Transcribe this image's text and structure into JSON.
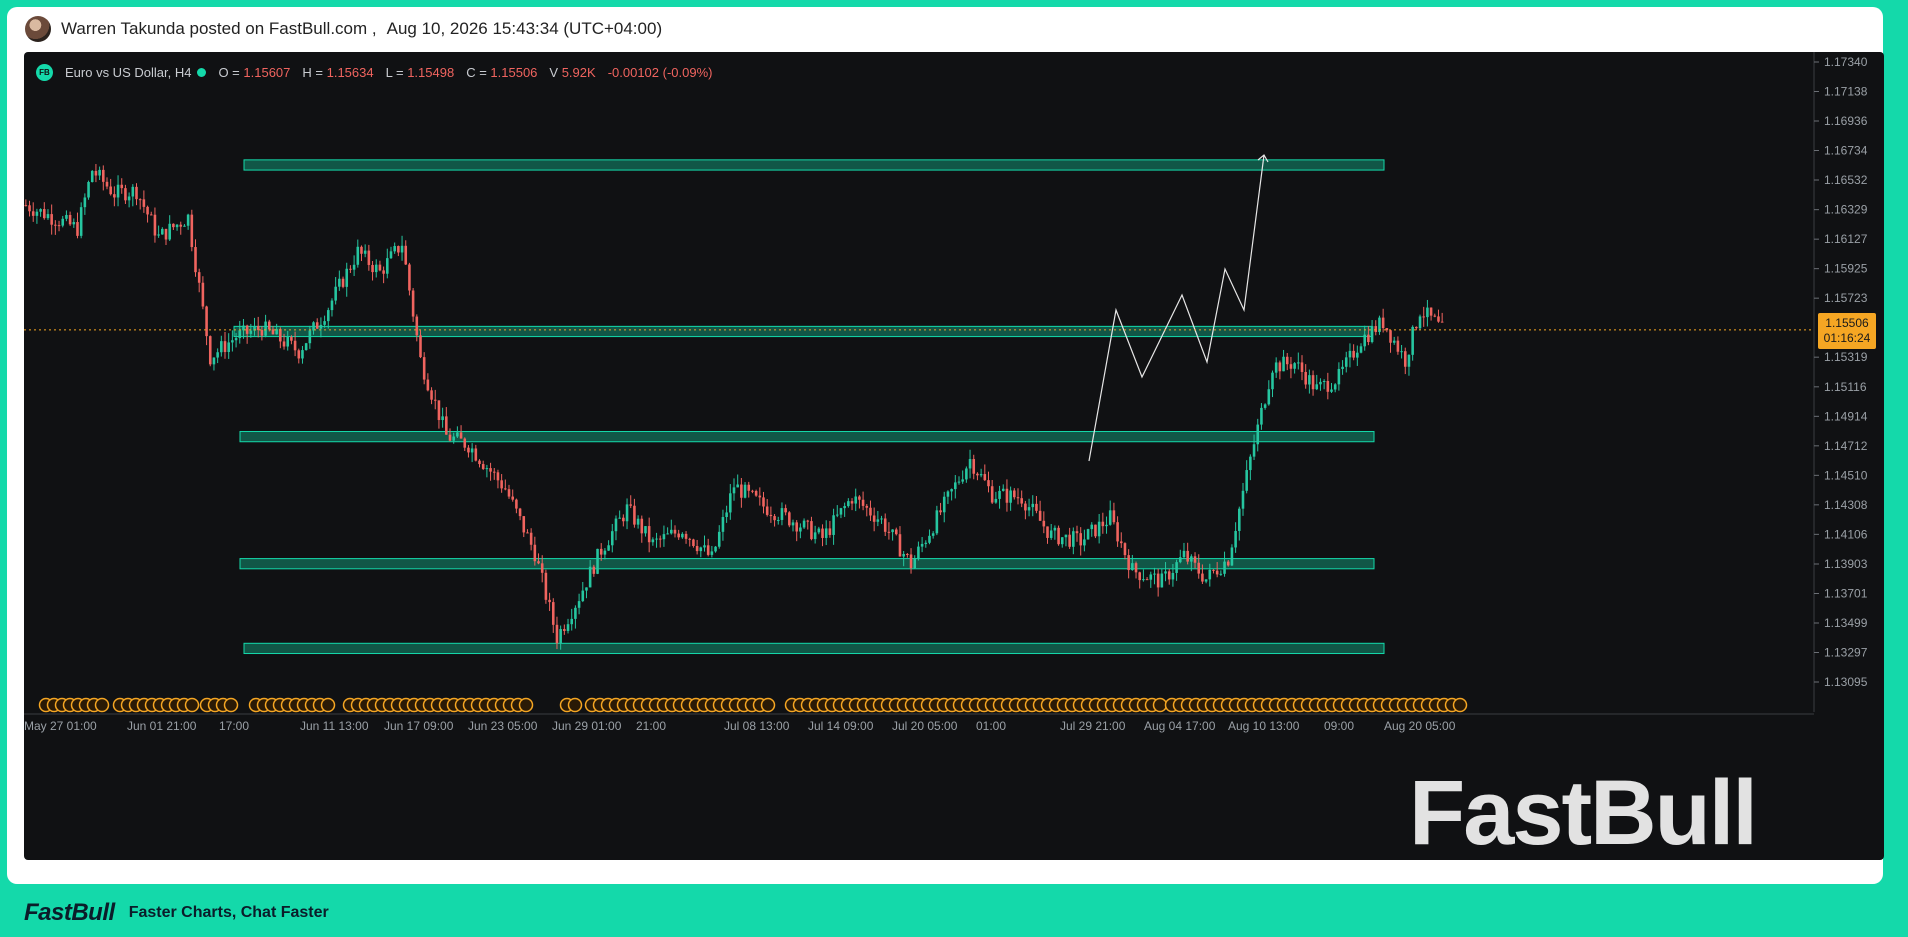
{
  "post": {
    "author_line": "Warren Takunda posted on FastBull.com ,",
    "timestamp": "Aug 10, 2026 15:43:34 (UTC+04:00)"
  },
  "legend": {
    "symbol": "Euro vs US Dollar, H4",
    "badge": "FB",
    "o_label": "O =",
    "o": "1.15607",
    "h_label": "H =",
    "h": "1.15634",
    "l_label": "L =",
    "l": "1.15498",
    "c_label": "C =",
    "c": "1.15506",
    "v_label": "V",
    "v": "5.92K",
    "change": "-0.00102 (-0.09%)"
  },
  "price_tag": {
    "price": "1.15506",
    "countdown": "01:16:24"
  },
  "watermark": "FastBull",
  "footer": {
    "logo": "FastBull",
    "tagline": "Faster Charts, Chat Faster"
  },
  "colors": {
    "up": "#26c6a0",
    "down": "#f0645f",
    "zone": "#14d9aa",
    "background": "#101113",
    "event_marker": "#f5a623",
    "brand": "#14d9aa"
  },
  "chart_data": {
    "type": "candlestick",
    "symbol": "EURUSD",
    "timeframe": "H4",
    "y_ticks": [
      "1.17340",
      "1.17138",
      "1.16936",
      "1.16734",
      "1.16532",
      "1.16329",
      "1.16127",
      "1.15925",
      "1.15723",
      "1.15506",
      "1.15319",
      "1.15116",
      "1.14914",
      "1.14712",
      "1.14510",
      "1.14308",
      "1.14106",
      "1.13903",
      "1.13701",
      "1.13499",
      "1.13297",
      "1.13095"
    ],
    "ylim": [
      1.13,
      1.174
    ],
    "x_ticks": [
      "May 27 01:00",
      "Jun 01 21:00",
      "17:00",
      "Jun 11 13:00",
      "Jun 17 09:00",
      "Jun 23 05:00",
      "Jun 29 01:00",
      "21:00",
      "Jul 08 13:00",
      "Jul 14 09:00",
      "Jul 20 05:00",
      "01:00",
      "Jul 29 21:00",
      "Aug 04 17:00",
      "Aug 10 13:00",
      "09:00",
      "Aug 20 05:00"
    ],
    "last_price": 1.15506,
    "zones": [
      {
        "from": 1.166,
        "to": 1.1667
      },
      {
        "from": 1.1546,
        "to": 1.1553
      },
      {
        "from": 1.1474,
        "to": 1.1481
      },
      {
        "from": 1.1387,
        "to": 1.1394
      },
      {
        "from": 1.1329,
        "to": 1.1336
      }
    ],
    "path_points": [
      {
        "x": "Jul 29 21:00",
        "y": 1.1447
      },
      {
        "x": "Jul 31 09:00",
        "y": 1.155
      },
      {
        "x": "Aug 02 05:00",
        "y": 1.1508
      },
      {
        "x": "Aug 04 17:00",
        "y": 1.1561
      },
      {
        "x": "Aug 06 09:00",
        "y": 1.1518
      },
      {
        "x": "Aug 08 05:00",
        "y": 1.158
      },
      {
        "x": "Aug 10 13:00",
        "y": 1.155
      },
      {
        "x": "Aug 12 01:00",
        "y": 1.1658
      }
    ],
    "keypoints": [
      {
        "t": 0,
        "p": 1.1636
      },
      {
        "t": 7,
        "p": 1.1628
      },
      {
        "t": 14,
        "p": 1.162
      },
      {
        "t": 18,
        "p": 1.166
      },
      {
        "t": 24,
        "p": 1.1644
      },
      {
        "t": 30,
        "p": 1.1646
      },
      {
        "t": 36,
        "p": 1.1614
      },
      {
        "t": 44,
        "p": 1.1628
      },
      {
        "t": 50,
        "p": 1.1532
      },
      {
        "t": 57,
        "p": 1.1546
      },
      {
        "t": 64,
        "p": 1.1552
      },
      {
        "t": 74,
        "p": 1.1536
      },
      {
        "t": 82,
        "p": 1.1566
      },
      {
        "t": 90,
        "p": 1.1604
      },
      {
        "t": 96,
        "p": 1.159
      },
      {
        "t": 102,
        "p": 1.161
      },
      {
        "t": 107,
        "p": 1.153
      },
      {
        "t": 114,
        "p": 1.1478
      },
      {
        "t": 120,
        "p": 1.1472
      },
      {
        "t": 130,
        "p": 1.1442
      },
      {
        "t": 138,
        "p": 1.1398
      },
      {
        "t": 144,
        "p": 1.134
      },
      {
        "t": 150,
        "p": 1.1368
      },
      {
        "t": 156,
        "p": 1.14
      },
      {
        "t": 163,
        "p": 1.1428
      },
      {
        "t": 170,
        "p": 1.1404
      },
      {
        "t": 178,
        "p": 1.1414
      },
      {
        "t": 186,
        "p": 1.1394
      },
      {
        "t": 192,
        "p": 1.1444
      },
      {
        "t": 200,
        "p": 1.143
      },
      {
        "t": 208,
        "p": 1.142
      },
      {
        "t": 216,
        "p": 1.1408
      },
      {
        "t": 224,
        "p": 1.1436
      },
      {
        "t": 232,
        "p": 1.142
      },
      {
        "t": 240,
        "p": 1.139
      },
      {
        "t": 248,
        "p": 1.1426
      },
      {
        "t": 256,
        "p": 1.1462
      },
      {
        "t": 262,
        "p": 1.1438
      },
      {
        "t": 270,
        "p": 1.1436
      },
      {
        "t": 278,
        "p": 1.141
      },
      {
        "t": 286,
        "p": 1.1406
      },
      {
        "t": 294,
        "p": 1.1422
      },
      {
        "t": 300,
        "p": 1.1386
      },
      {
        "t": 308,
        "p": 1.1378
      },
      {
        "t": 314,
        "p": 1.1396
      },
      {
        "t": 320,
        "p": 1.138
      },
      {
        "t": 326,
        "p": 1.1394
      },
      {
        "t": 332,
        "p": 1.1462
      },
      {
        "t": 338,
        "p": 1.1526
      },
      {
        "t": 344,
        "p": 1.1528
      },
      {
        "t": 350,
        "p": 1.151
      },
      {
        "t": 356,
        "p": 1.1518
      },
      {
        "t": 362,
        "p": 1.1544
      },
      {
        "t": 368,
        "p": 1.1556
      },
      {
        "t": 374,
        "p": 1.153
      },
      {
        "t": 378,
        "p": 1.1564
      },
      {
        "t": 382,
        "p": 1.1556
      },
      {
        "t": 384,
        "p": 1.155
      }
    ]
  }
}
